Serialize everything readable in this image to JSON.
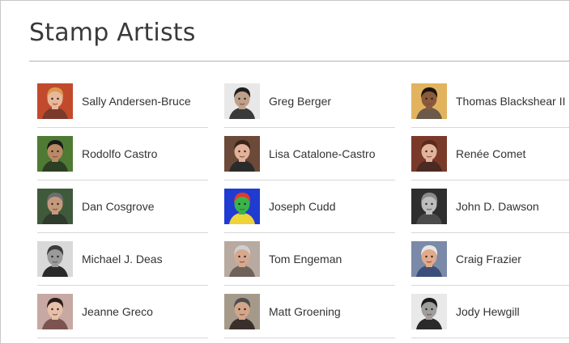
{
  "page": {
    "title": "Stamp Artists"
  },
  "artists": [
    {
      "name": "Sally Andersen-Bruce",
      "portrait": "portrait-photo",
      "colors": {
        "bg": "#c24a2c",
        "hair": "#d99a4f",
        "skin": "#e9b89a",
        "shirt": "#7a3b2d"
      }
    },
    {
      "name": "Greg Berger",
      "portrait": "portrait-photo",
      "colors": {
        "bg": "#e8e8e8",
        "hair": "#1e1e1e",
        "skin": "#bfa08a",
        "shirt": "#3a3a3a"
      }
    },
    {
      "name": "Thomas Blackshear II",
      "portrait": "portrait-photo",
      "colors": {
        "bg": "#e2b35e",
        "hair": "#1b1410",
        "skin": "#8a5a3c",
        "shirt": "#6b5a4a"
      }
    },
    {
      "name": "Rodolfo Castro",
      "portrait": "portrait-photo",
      "colors": {
        "bg": "#4f7a34",
        "hair": "#1a1a1a",
        "skin": "#b98a65",
        "shirt": "#2c3f24"
      }
    },
    {
      "name": "Lisa Catalone-Castro",
      "portrait": "portrait-photo",
      "colors": {
        "bg": "#6b4a3a",
        "hair": "#3d2418",
        "skin": "#e1b299",
        "shirt": "#2b2b2b"
      }
    },
    {
      "name": "Renée Comet",
      "portrait": "portrait-photo",
      "colors": {
        "bg": "#7a3a2a",
        "hair": "#5a2a1c",
        "skin": "#e3b49b",
        "shirt": "#4a2a22"
      }
    },
    {
      "name": "Dan Cosgrove",
      "portrait": "portrait-photo",
      "colors": {
        "bg": "#3f5a3a",
        "hair": "#6e6e6e",
        "skin": "#c59a7c",
        "shirt": "#2f3b2d"
      }
    },
    {
      "name": "Joseph Cudd",
      "portrait": "illustrated-portrait",
      "colors": {
        "bg": "#1f3bd1",
        "hair": "#e23a2a",
        "skin": "#38b54a",
        "shirt": "#f0d23a"
      }
    },
    {
      "name": "John D. Dawson",
      "portrait": "portrait-photo",
      "colors": {
        "bg": "#2e2e2e",
        "hair": "#8a8a8a",
        "skin": "#bdbdbd",
        "shirt": "#4b4b4b"
      }
    },
    {
      "name": "Michael J. Deas",
      "portrait": "portrait-photo",
      "colors": {
        "bg": "#d9d9d9",
        "hair": "#3b3b3b",
        "skin": "#9a9a9a",
        "shirt": "#2a2a2a"
      }
    },
    {
      "name": "Tom Engeman",
      "portrait": "portrait-photo",
      "colors": {
        "bg": "#b8aaa0",
        "hair": "#cfcfcf",
        "skin": "#d6a98f",
        "shirt": "#6f6258"
      }
    },
    {
      "name": "Craig Frazier",
      "portrait": "portrait-photo",
      "colors": {
        "bg": "#7a8aa8",
        "hair": "#e7e7e7",
        "skin": "#e2a98a",
        "shirt": "#3b4f7a"
      }
    },
    {
      "name": "Jeanne Greco",
      "portrait": "portrait-photo",
      "colors": {
        "bg": "#c7a8a2",
        "hair": "#2a1d1a",
        "skin": "#e7c0aa",
        "shirt": "#7b5450"
      }
    },
    {
      "name": "Matt Groening",
      "portrait": "portrait-photo",
      "colors": {
        "bg": "#a59a8a",
        "hair": "#4d4d4d",
        "skin": "#d3a68a",
        "shirt": "#3a2f2a"
      }
    },
    {
      "name": "Jody Hewgill",
      "portrait": "portrait-photo",
      "colors": {
        "bg": "#e9e9e9",
        "hair": "#1b1b1b",
        "skin": "#9e9e9e",
        "shirt": "#2a2a2a"
      }
    }
  ]
}
